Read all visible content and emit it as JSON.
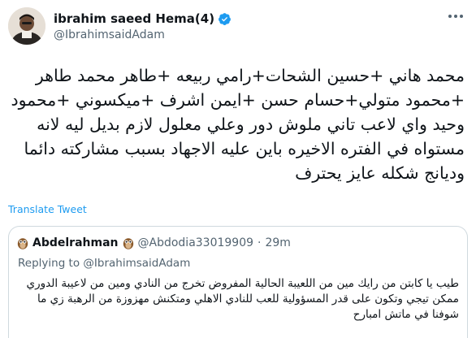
{
  "tweet": {
    "author": {
      "display_name": "ibrahim saeed Hema(4)",
      "handle": "@IbrahimsaidAdam",
      "verified": true
    },
    "text": "محمد هاني +حسين الشحات+رامي ربيعه +طاهر محمد طاهر +محمود متولي+حسام حسن +ايمن اشرف +ميكسوني +محمود وحيد واي لاعب تاني ملوش دور وعلي معلول لازم بديل ليه لانه مستواه في الفتره الاخيره باين عليه الاجهاد بسبب مشاركته دائما وديانج شكله عايز يحترف",
    "translate_label": "Translate Tweet"
  },
  "quote": {
    "author": {
      "display_name": "Abdelrahman",
      "handle": "@Abdodia33019909",
      "time": "29m",
      "emoji_icon": "owl-icon"
    },
    "separator": "·",
    "replying_to": "Replying to @IbrahimsaidAdam",
    "text": "طيب يا كابتن من رايك مين من اللعيبة الحالية المفروض تخرج من النادي ومين من لاعيبة الدوري ممكن تيجي وتكون على قدر المسؤولية للعب للنادي الاهلي ومتكنش مهزوزة من الرهبة زي ما شوفنا في ماتش امبارح"
  },
  "colors": {
    "text": "#0f1419",
    "secondary": "#536471",
    "link": "#1d9bf0",
    "border": "#cfd9de",
    "verified": "#1d9bf0"
  }
}
